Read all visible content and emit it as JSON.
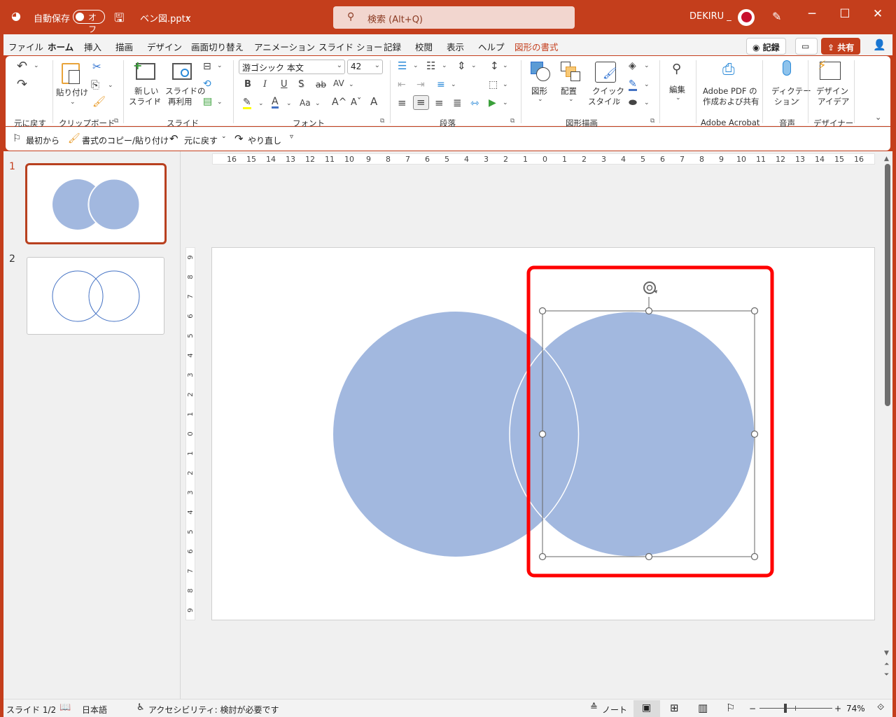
{
  "titlebar": {
    "autosave_label": "自動保存",
    "autosave_state": "オフ",
    "filename": "ベン図.pptx",
    "search_placeholder": "検索 (Alt+Q)",
    "user": "DEKIRU _",
    "icons": {
      "app": "powerpoint-icon",
      "save": "save-icon",
      "search": "search-icon",
      "pen": "designer-pen-icon",
      "minimize": "minimize-icon",
      "maximize": "maximize-icon",
      "close": "close-icon"
    }
  },
  "tabs": [
    "ファイル",
    "ホーム",
    "挿入",
    "描画",
    "デザイン",
    "画面切り替え",
    "アニメーション",
    "スライド ショー",
    "記録",
    "校閲",
    "表示",
    "ヘルプ",
    "図形の書式"
  ],
  "active_tab": "ホーム",
  "tab_actions": {
    "record": "記録",
    "share": "共有"
  },
  "ribbon": {
    "undo_group": "元に戻す",
    "clipboard": {
      "paste": "貼り付け",
      "group": "クリップボード"
    },
    "slides": {
      "new_slide_1": "新しい",
      "new_slide_2": "スライド",
      "reuse_1": "スライドの",
      "reuse_2": "再利用",
      "group": "スライド"
    },
    "font": {
      "name": "游ゴシック 本文",
      "size": "42",
      "group": "フォント",
      "bold": "B",
      "italic": "I",
      "underline": "U",
      "shadow": "S",
      "strike": "ab",
      "spacing": "AV",
      "case": "Aa",
      "grow": "A^",
      "shrink": "Aˇ",
      "clear": "A"
    },
    "paragraph": {
      "group": "段落"
    },
    "drawing": {
      "shapes": "図形",
      "arrange": "配置",
      "quick_style_1": "クイック",
      "quick_style_2": "スタイル",
      "group": "図形描画"
    },
    "editing": {
      "label": "編集"
    },
    "acrobat": {
      "line1": "Adobe PDF の",
      "line2": "作成および共有",
      "group": "Adobe Acrobat"
    },
    "voice": {
      "line1": "ディクテー",
      "line2": "ション",
      "group": "音声"
    },
    "designer": {
      "line1": "デザイン",
      "line2": "アイデア",
      "group": "デザイナー"
    }
  },
  "qat": [
    "最初から",
    "書式のコピー/貼り付け",
    "元に戻す",
    "やり直し"
  ],
  "thumbnails": [
    {
      "number": "1",
      "style": "filled",
      "selected": true
    },
    {
      "number": "2",
      "style": "outline",
      "selected": false
    }
  ],
  "ruler": {
    "h_left": [
      "16",
      "15",
      "14",
      "13",
      "12",
      "11",
      "10",
      "9",
      "8",
      "7",
      "6",
      "5",
      "4",
      "3",
      "2",
      "1",
      "0"
    ],
    "h_right": [
      "1",
      "2",
      "3",
      "4",
      "5",
      "6",
      "7",
      "8",
      "9",
      "10",
      "11",
      "12",
      "13",
      "14",
      "15",
      "16"
    ],
    "v": [
      "9",
      "8",
      "7",
      "6",
      "5",
      "4",
      "3",
      "2",
      "1",
      "0",
      "1",
      "2",
      "3",
      "4",
      "5",
      "6",
      "7",
      "8",
      "9"
    ]
  },
  "slide": {
    "circle_fill": "#a2b8df",
    "highlight_color": "#ff0000"
  },
  "status": {
    "slide_info": "スライド 1/2",
    "language": "日本語",
    "accessibility": "アクセシビリティ: 検討が必要です",
    "notes": "ノート",
    "zoom_minus": "−",
    "zoom_plus": "+",
    "zoom": "74%",
    "zoom_level": 0.74
  }
}
